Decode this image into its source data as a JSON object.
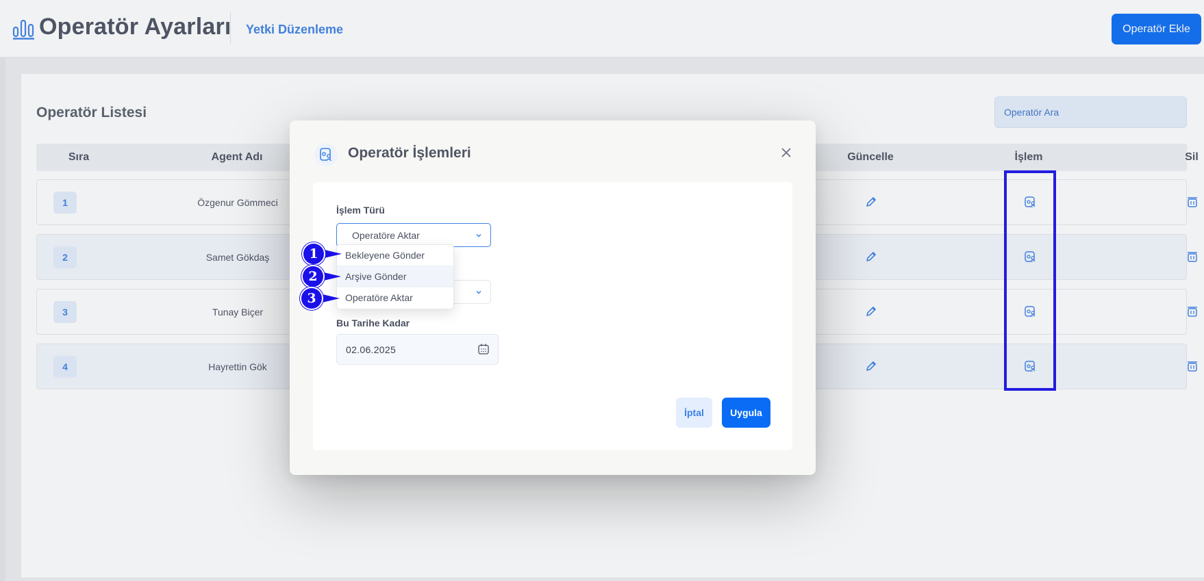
{
  "header": {
    "title": "Operatör Ayarları",
    "tab": "Yetki Düzenleme",
    "add_button": "Operatör Ekle",
    "logo_icon": "bar-chart-icon"
  },
  "list": {
    "title": "Operatör Listesi",
    "search_placeholder": "Operatör Ara",
    "columns": {
      "sira": "Sıra",
      "agent": "Agent Adı",
      "guncelle": "Güncelle",
      "islem": "İşlem",
      "sil": "Sil"
    },
    "rows": [
      {
        "index": "1",
        "agent": "Özgenur Gömmeci"
      },
      {
        "index": "2",
        "agent": "Samet Gökdaş"
      },
      {
        "index": "3",
        "agent": "Tunay Biçer"
      },
      {
        "index": "4",
        "agent": "Hayrettin Gök"
      }
    ]
  },
  "modal": {
    "title": "Operatör İşlemleri",
    "icon": "user-settings-icon",
    "islem_turu_label": "İşlem Türü",
    "islem_turu_value": "Operatöre Aktar",
    "date_label": "Bu Tarihe Kadar",
    "date_value": "02.06.2025",
    "cancel": "İptal",
    "apply": "Uygula"
  },
  "dropdown": {
    "options": [
      "Bekleyene Gönder",
      "Arşive Gönder",
      "Operatöre Aktar"
    ]
  },
  "annotations": [
    "1",
    "2",
    "3"
  ],
  "colors": {
    "primary": "#0a6cf5",
    "accent_text": "#3d82e6",
    "highlight": "#1a10e8"
  }
}
